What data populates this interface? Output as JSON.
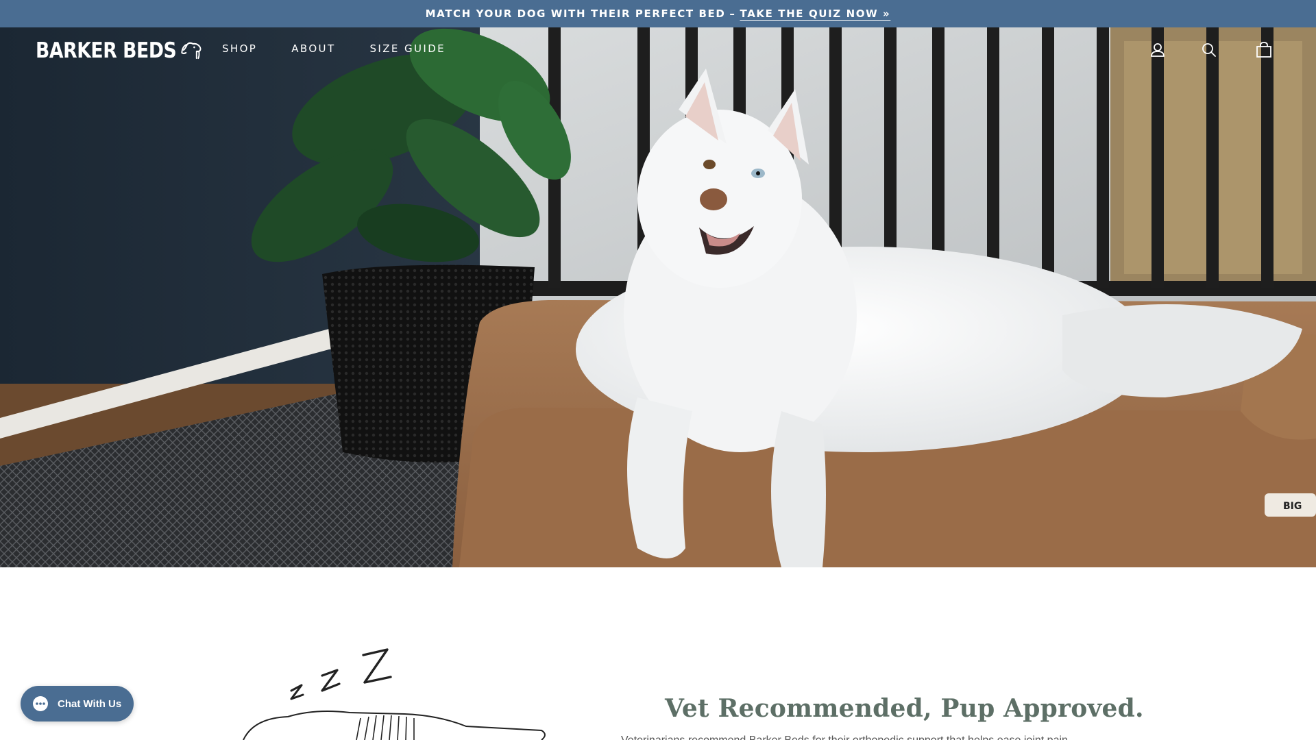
{
  "announcement": {
    "text": "MATCH YOUR DOG WITH THEIR PERFECT BED",
    "separator": "–",
    "link": "TAKE THE QUIZ NOW »"
  },
  "header": {
    "logo_text": "BARKER BEDS",
    "nav": [
      {
        "label": "SHOP"
      },
      {
        "label": "ABOUT"
      },
      {
        "label": "SIZE GUIDE"
      }
    ],
    "icons": [
      "account-icon",
      "search-icon",
      "cart-icon"
    ]
  },
  "hero": {
    "image": "white dog lying on a brown bolster dog bed next to a potted plant"
  },
  "section": {
    "heading": "Vet Recommended, Pup Approved.",
    "body": "Veterinarians recommend Barker Beds for their orthopedic support that helps ease joint pain"
  },
  "chat": {
    "label": "Chat With Us"
  },
  "colors": {
    "announcement_bg": "#4a6d92",
    "heading": "#5d6f66",
    "chat_bg": "#4a6d92"
  }
}
